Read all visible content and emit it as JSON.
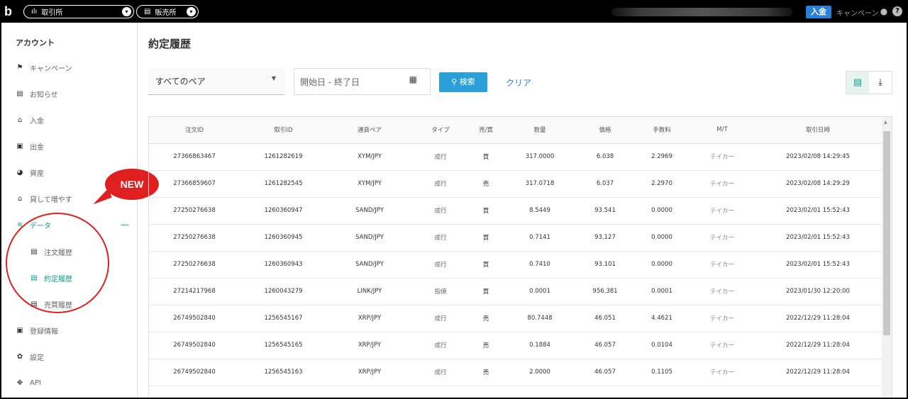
{
  "topbar": {
    "logo": "b",
    "exchange_tab": {
      "icon": "bar-chart-icon",
      "label": "取引所"
    },
    "store_tab": {
      "icon": "store-icon",
      "label": "販売所"
    },
    "deposit_label": "入金",
    "campaign_label": "キャンペーン",
    "help": "?"
  },
  "sidebar": {
    "heading": "アカウント",
    "items": [
      {
        "icon": "flag-icon",
        "label": "キャンペーン"
      },
      {
        "icon": "notice-icon",
        "label": "お知らせ"
      },
      {
        "icon": "bank-icon",
        "label": "入金"
      },
      {
        "icon": "withdraw-icon",
        "label": "出金"
      },
      {
        "icon": "pie-icon",
        "label": "資産"
      },
      {
        "icon": "bank-icon",
        "label": "貸して増やす"
      },
      {
        "icon": "database-icon",
        "label": "データ"
      },
      {
        "icon": "doc-icon",
        "label": "注文履歴"
      },
      {
        "icon": "doc-icon",
        "label": "約定履歴"
      },
      {
        "icon": "doc-icon",
        "label": "売買履歴"
      },
      {
        "icon": "id-card-icon",
        "label": "登録情報"
      },
      {
        "icon": "gear-icon",
        "label": "設定"
      },
      {
        "icon": "api-icon",
        "label": "API"
      }
    ],
    "collapse_symbol": "—"
  },
  "annotation": {
    "new_label": "NEW"
  },
  "main": {
    "title": "約定履歴",
    "pair_select": "すべてのペア",
    "date_placeholder": "開始日 - 終了日",
    "search_label": "検索",
    "clear_label": "クリア"
  },
  "table": {
    "headers": [
      "注文ID",
      "取引ID",
      "通貨ペア",
      "タイプ",
      "売/買",
      "数量",
      "価格",
      "手数料",
      "M/T",
      "取引日時"
    ],
    "rows": [
      [
        "27366863467",
        "1261282619",
        "XYM/JPY",
        "成行",
        "買",
        "317.0000",
        "6.038",
        "2.2969",
        "テイカー",
        "2023/02/08 14:29:45"
      ],
      [
        "27366859607",
        "1261282545",
        "XYM/JPY",
        "成行",
        "売",
        "317.0718",
        "6.037",
        "2.2970",
        "テイカー",
        "2023/02/08 14:29:29"
      ],
      [
        "27250276638",
        "1260360947",
        "SAND/JPY",
        "成行",
        "買",
        "8.5449",
        "93.541",
        "0.0000",
        "テイカー",
        "2023/02/01 15:52:43"
      ],
      [
        "27250276638",
        "1260360945",
        "SAND/JPY",
        "成行",
        "買",
        "0.7141",
        "93.127",
        "0.0000",
        "テイカー",
        "2023/02/01 15:52:43"
      ],
      [
        "27250276638",
        "1260360943",
        "SAND/JPY",
        "成行",
        "買",
        "0.7410",
        "93.101",
        "0.0000",
        "テイカー",
        "2023/02/01 15:52:43"
      ],
      [
        "27214217968",
        "1260043279",
        "LINK/JPY",
        "指値",
        "買",
        "0.0001",
        "956.381",
        "0.0001",
        "テイカー",
        "2023/01/30 12:20:00"
      ],
      [
        "26749502840",
        "1256545167",
        "XRP/JPY",
        "成行",
        "売",
        "80.7448",
        "46.051",
        "4.4621",
        "テイカー",
        "2022/12/29 11:28:04"
      ],
      [
        "26749502840",
        "1256545165",
        "XRP/JPY",
        "成行",
        "売",
        "0.1884",
        "46.057",
        "0.0104",
        "テイカー",
        "2022/12/29 11:28:04"
      ],
      [
        "26749502840",
        "1256545163",
        "XRP/JPY",
        "成行",
        "売",
        "2.0000",
        "46.057",
        "0.1105",
        "テイカー",
        "2022/12/29 11:28:04"
      ]
    ]
  }
}
